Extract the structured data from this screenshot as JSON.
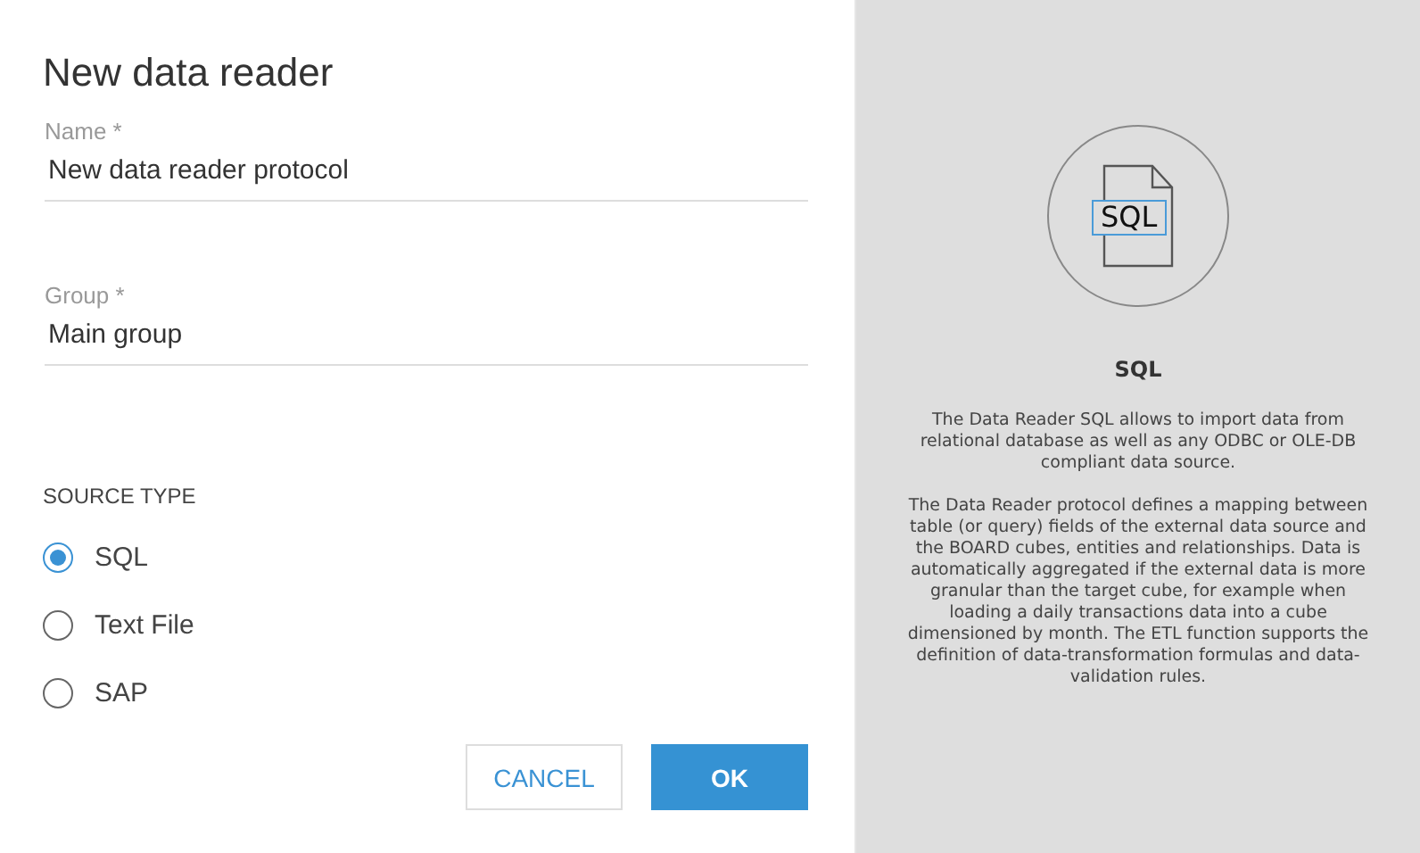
{
  "dialog": {
    "title": "New data reader"
  },
  "fields": [
    {
      "label": "Name *",
      "value": "New data reader protocol"
    },
    {
      "label": "Group *",
      "value": "Main group"
    }
  ],
  "source_type": {
    "label": "SOURCE TYPE",
    "options": [
      {
        "label": "SQL",
        "selected": true
      },
      {
        "label": "Text File",
        "selected": false
      },
      {
        "label": "SAP",
        "selected": false
      }
    ]
  },
  "buttons": [
    {
      "label": "CANCEL",
      "kind": "secondary"
    },
    {
      "label": "OK",
      "kind": "primary"
    }
  ],
  "info": {
    "icon_label": "SQL",
    "title": "SQL",
    "paragraphs": [
      "The Data Reader SQL allows to import data from relational database as well as any ODBC or OLE-DB compliant data source.",
      "The Data Reader protocol defines a mapping between table (or query) fields of the external data source and the BOARD cubes, entities and relationships. Data is automatically aggregated if the external data is more granular than the target cube, for example when loading a daily transactions data into a cube dimensioned by month. The ETL function supports the definition of data-transformation formulas and data-validation rules."
    ]
  }
}
